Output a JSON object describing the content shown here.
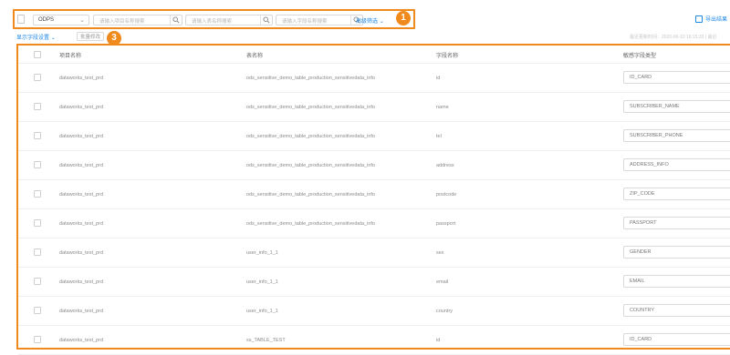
{
  "filter_bar": {
    "database_type": "ODPS",
    "input_1_placeholder": "请输入项目名称搜索",
    "input_2_placeholder": "请输入表名称搜索",
    "input_3_placeholder": "请输入字段名称搜索",
    "advanced_filter": "高级筛选"
  },
  "badges": {
    "one": "1",
    "three": "3"
  },
  "top_right": {
    "label": "导出结果"
  },
  "toolbar": {
    "show_fields": "显示字段设置",
    "batch_modify": "批量修改",
    "update_info": "最近更新时间：2020-06-10 16:15:33 | 最近"
  },
  "table": {
    "headers": [
      "项目名称",
      "表名称",
      "字段名称",
      "敏感字段类型"
    ],
    "rows": [
      {
        "project": "dataworks_test_prd",
        "table": "ods_sensitive_demo_table_production_sensitivedata_info",
        "field": "id",
        "type": "ID_CARD"
      },
      {
        "project": "dataworks_test_prd",
        "table": "ods_sensitive_demo_table_production_sensitivedata_info",
        "field": "name",
        "type": "SUBSCRIBER_NAME"
      },
      {
        "project": "dataworks_test_prd",
        "table": "ods_sensitive_demo_table_production_sensitivedata_info",
        "field": "tel",
        "type": "SUBSCRIBER_PHONE"
      },
      {
        "project": "dataworks_test_prd",
        "table": "ods_sensitive_demo_table_production_sensitivedata_info",
        "field": "address",
        "type": "ADDRESS_INFO"
      },
      {
        "project": "dataworks_test_prd",
        "table": "ods_sensitive_demo_table_production_sensitivedata_info",
        "field": "postcode",
        "type": "ZIP_CODE"
      },
      {
        "project": "dataworks_test_prd",
        "table": "ods_sensitive_demo_table_production_sensitivedata_info",
        "field": "passport",
        "type": "PASSPORT"
      },
      {
        "project": "dataworks_test_prd",
        "table": "user_info_1_1",
        "field": "sex",
        "type": "GENDER"
      },
      {
        "project": "dataworks_test_prd",
        "table": "user_info_1_1",
        "field": "email",
        "type": "EMAIL"
      },
      {
        "project": "dataworks_test_prd",
        "table": "user_info_1_1",
        "field": "country",
        "type": "COUNTRY"
      },
      {
        "project": "dataworks_test_prd",
        "table": "ss_TABLE_TEST",
        "field": "id",
        "type": "ID_CARD"
      }
    ]
  }
}
